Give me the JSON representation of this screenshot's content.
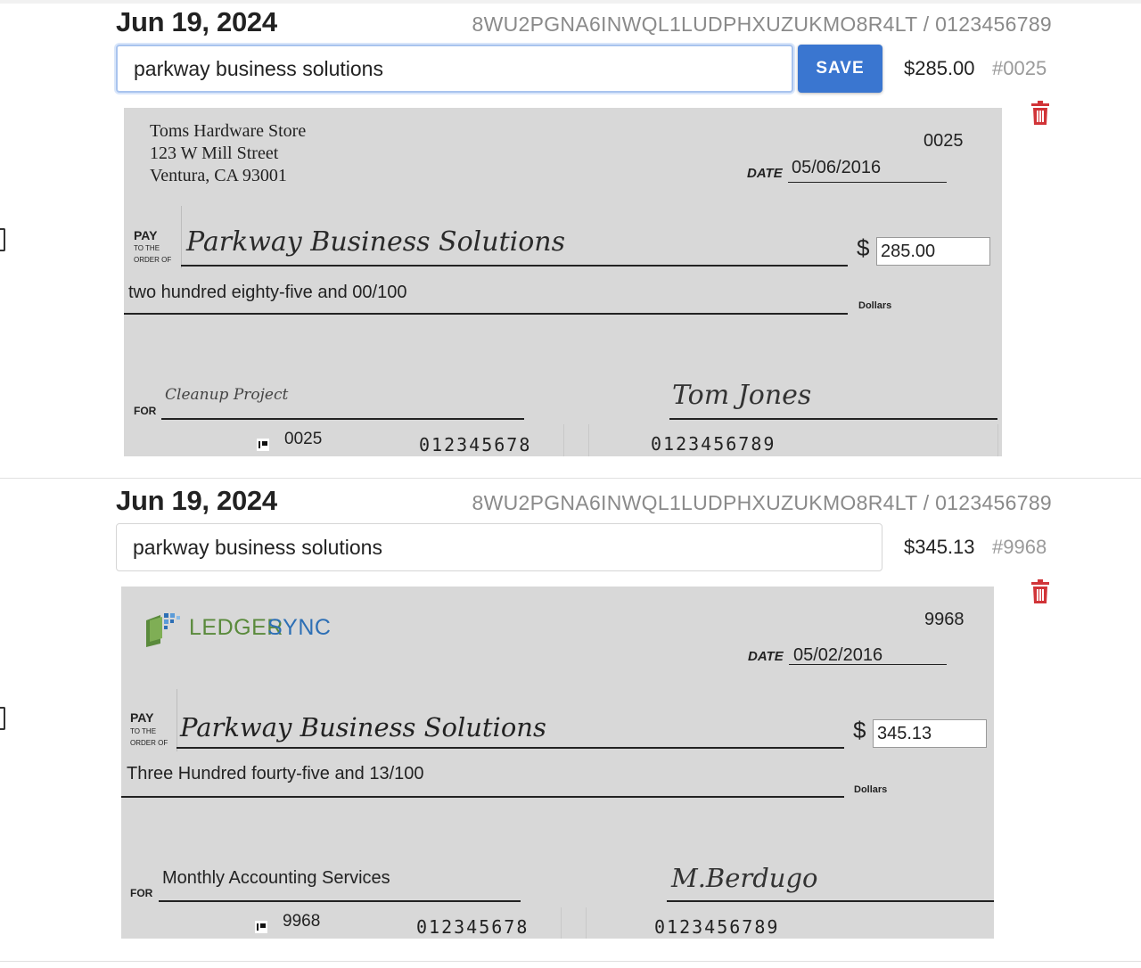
{
  "entries": [
    {
      "date": "Jun 19, 2024",
      "account": "8WU2PGNA6INWQL1LUDPHXUZUKMO8R4LT / 0123456789",
      "payee_value": "parkway business solutions",
      "save_label": "SAVE",
      "amount": "$285.00",
      "check_number": "#0025",
      "check": {
        "issuer_lines": [
          "Toms Hardware Store",
          "123 W Mill Street",
          "Ventura, CA 93001"
        ],
        "number": "0025",
        "date_label": "DATE",
        "date": "05/06/2016",
        "pay_label": "PAY",
        "order_label_1": "TO THE",
        "order_label_2": "ORDER OF",
        "payee": "Parkway Business Solutions",
        "dollar_sign": "$",
        "amount": "285.00",
        "amount_words": "two hundred eighty-five and 00/100",
        "dollars_label": "Dollars",
        "for_label": "FOR",
        "memo": "Cleanup Project",
        "signature": "Tom Jones",
        "micr_check": "0025",
        "micr_routing": "012345678",
        "micr_account": "0123456789"
      }
    },
    {
      "date": "Jun 19, 2024",
      "account": "8WU2PGNA6INWQL1LUDPHXUZUKMO8R4LT / 0123456789",
      "payee_value": "parkway business solutions",
      "amount": "$345.13",
      "check_number": "#9968",
      "check": {
        "logo_text_1": "LEDGER",
        "logo_text_2": "SYNC",
        "number": "9968",
        "date_label": "DATE",
        "date": "05/02/2016",
        "pay_label": "PAY",
        "order_label_1": "TO THE",
        "order_label_2": "ORDER OF",
        "payee": "Parkway Business Solutions",
        "dollar_sign": "$",
        "amount": "345.13",
        "amount_words": "Three Hundred fourty-five and 13/100",
        "dollars_label": "Dollars",
        "for_label": "FOR",
        "memo": "Monthly Accounting Services",
        "signature": "M.Berdugo",
        "micr_check": "9968",
        "micr_routing": "012345678",
        "micr_account": "0123456789"
      }
    }
  ],
  "colors": {
    "save_button": "#3a76d0",
    "trash_icon": "#d13438",
    "logo_green": "#5a8a3c",
    "logo_blue": "#2d6fb5"
  }
}
